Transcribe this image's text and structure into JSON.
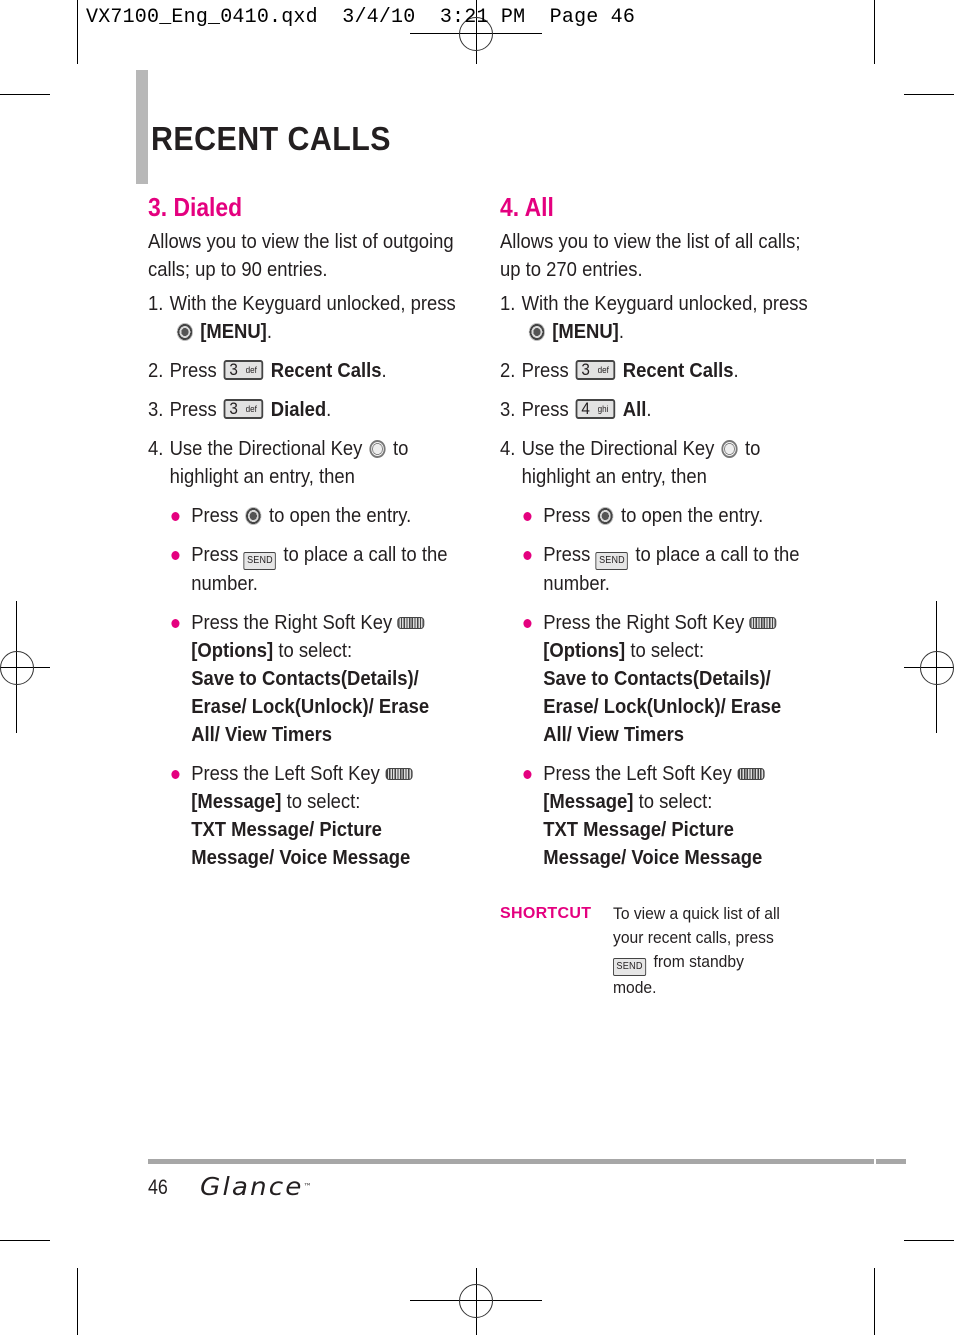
{
  "slug": "VX7100_Eng_0410.qxd  3/4/10  3:21 PM  Page 46",
  "page_title": "RECENT CALLS",
  "sections": [
    {
      "title": "3. Dialed",
      "intro": "Allows you to view the list of outgoing calls; up to 90 entries.",
      "steps": [
        {
          "num": "1.",
          "text": "With the Keyguard unlocked, press",
          "icon": "ok-key",
          "bold": "[MENU]",
          "after": "."
        },
        {
          "num": "2.",
          "text": "Press",
          "key_digit": "3",
          "key_letters": "def",
          "bold": "Recent Calls",
          "after": "."
        },
        {
          "num": "3.",
          "text": "Press",
          "key_digit": "3",
          "key_letters": "def",
          "bold": "Dialed",
          "after": "."
        },
        {
          "num": "4.",
          "text": "Use the Directional Key",
          "icon": "directional-key",
          "after": "to highlight an entry, then"
        }
      ],
      "bullets": [
        {
          "pre": "Press",
          "icon": "ok-key",
          "post": "to open the entry."
        },
        {
          "pre": "Press",
          "icon": "send-key",
          "icon_label": "SEND",
          "post": "to place a call to the number."
        },
        {
          "pre": "Press the Right Soft Key",
          "icon": "right-soft-key",
          "bold_label": "[Options]",
          "mid": "to select:",
          "options": "Save to Contacts(Details)/ Erase/ Lock(Unlock)/ Erase All/ View Timers"
        },
        {
          "pre": "Press the Left Soft Key",
          "icon": "left-soft-key",
          "bold_label": "[Message]",
          "mid": "to select:",
          "options": "TXT Message/ Picture Message/ Voice Message"
        }
      ]
    },
    {
      "title": "4. All",
      "intro": "Allows you to view the list of all calls; up to 270 entries.",
      "steps": [
        {
          "num": "1.",
          "text": "With the Keyguard unlocked, press",
          "icon": "ok-key",
          "bold": "[MENU]",
          "after": "."
        },
        {
          "num": "2.",
          "text": "Press",
          "key_digit": "3",
          "key_letters": "def",
          "bold": "Recent Calls",
          "after": "."
        },
        {
          "num": "3.",
          "text": "Press",
          "key_digit": "4",
          "key_letters": "ghi",
          "bold": "All",
          "after": "."
        },
        {
          "num": "4.",
          "text": "Use the Directional Key",
          "icon": "directional-key",
          "after": "to highlight an entry, then"
        }
      ],
      "bullets": [
        {
          "pre": "Press",
          "icon": "ok-key",
          "post": "to open the entry."
        },
        {
          "pre": "Press",
          "icon": "send-key",
          "icon_label": "SEND",
          "post": "to place a call to the number."
        },
        {
          "pre": "Press the Right Soft Key",
          "icon": "right-soft-key",
          "bold_label": "[Options]",
          "mid": "to select:",
          "options": "Save to Contacts(Details)/ Erase/ Lock(Unlock)/ Erase All/ View Timers"
        },
        {
          "pre": "Press the Left Soft Key",
          "icon": "left-soft-key",
          "bold_label": "[Message]",
          "mid": "to select:",
          "options": "TXT Message/ Picture Message/ Voice Message"
        }
      ]
    }
  ],
  "shortcut": {
    "label": "SHORTCUT",
    "text_before": "To view a quick list of all your recent calls, press",
    "key_label": "SEND",
    "text_after": "from standby mode."
  },
  "footer": {
    "page_number": "46",
    "brand": "Glance",
    "brand_mark": "™"
  },
  "colors": {
    "accent": "#e4007f",
    "text": "#231f20",
    "rule": "#a7a7a7"
  }
}
